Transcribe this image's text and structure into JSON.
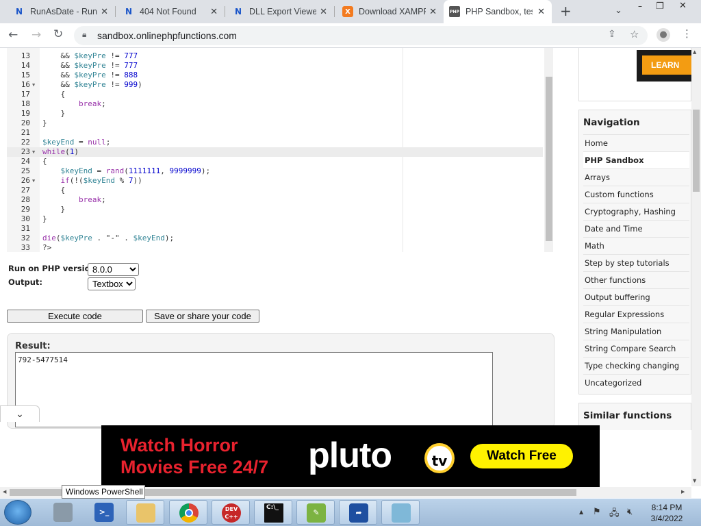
{
  "browser": {
    "tabs": [
      {
        "title": "RunAsDate - Run",
        "favicon": "N",
        "active": false
      },
      {
        "title": "404 Not Found",
        "favicon": "N",
        "active": false
      },
      {
        "title": "DLL Export Viewer",
        "favicon": "N",
        "active": false
      },
      {
        "title": "Download XAMPP",
        "favicon": "X",
        "active": false
      },
      {
        "title": "PHP Sandbox, tes",
        "favicon": "PHP",
        "active": true
      }
    ],
    "new_tab": "+",
    "url": "sandbox.onlinephpfunctions.com",
    "window_controls": {
      "minimize": "–",
      "restore": "❐",
      "close": "✕"
    }
  },
  "editor": {
    "lines": [
      {
        "n": "13",
        "fold": false,
        "code": "    && $keyPre != 777"
      },
      {
        "n": "14",
        "fold": false,
        "code": "    && $keyPre != 777"
      },
      {
        "n": "15",
        "fold": false,
        "code": "    && $keyPre != 888"
      },
      {
        "n": "16",
        "fold": true,
        "code": "    && $keyPre != 999)"
      },
      {
        "n": "17",
        "fold": false,
        "code": "    {"
      },
      {
        "n": "18",
        "fold": false,
        "code": "        break;"
      },
      {
        "n": "19",
        "fold": false,
        "code": "    }"
      },
      {
        "n": "20",
        "fold": false,
        "code": "}"
      },
      {
        "n": "21",
        "fold": false,
        "code": ""
      },
      {
        "n": "22",
        "fold": false,
        "code": "$keyEnd = null;"
      },
      {
        "n": "23",
        "fold": true,
        "code": "while(1)"
      },
      {
        "n": "24",
        "fold": false,
        "code": "{"
      },
      {
        "n": "25",
        "fold": false,
        "code": "    $keyEnd = rand(1111111, 9999999);"
      },
      {
        "n": "26",
        "fold": true,
        "code": "    if(!($keyEnd % 7))"
      },
      {
        "n": "27",
        "fold": false,
        "code": "    {"
      },
      {
        "n": "28",
        "fold": false,
        "code": "        break;"
      },
      {
        "n": "29",
        "fold": false,
        "code": "    }"
      },
      {
        "n": "30",
        "fold": false,
        "code": "}"
      },
      {
        "n": "31",
        "fold": false,
        "code": ""
      },
      {
        "n": "32",
        "fold": false,
        "code": "die($keyPre . \"-\" . $keyEnd);"
      },
      {
        "n": "33",
        "fold": false,
        "code": "?>"
      }
    ]
  },
  "controls": {
    "php_version_label": "Run on PHP version:",
    "php_version_value": "8.0.0",
    "output_label": "Output:",
    "output_value": "Textbox",
    "execute_label": "Execute code",
    "save_label": "Save or share your code"
  },
  "result": {
    "label": "Result:",
    "output": "792-5477514"
  },
  "sidebar": {
    "ad_button": "LEARN MORE",
    "nav_title": "Navigation",
    "items": [
      {
        "label": "Home",
        "current": false
      },
      {
        "label": "PHP Sandbox",
        "current": true
      },
      {
        "label": "Arrays",
        "current": false
      },
      {
        "label": "Custom functions",
        "current": false
      },
      {
        "label": "Cryptography, Hashing",
        "current": false
      },
      {
        "label": "Date and Time",
        "current": false
      },
      {
        "label": "Math",
        "current": false
      },
      {
        "label": "Step by step tutorials",
        "current": false
      },
      {
        "label": "Other functions",
        "current": false
      },
      {
        "label": "Output buffering",
        "current": false
      },
      {
        "label": "Regular Expressions",
        "current": false
      },
      {
        "label": "String Manipulation",
        "current": false
      },
      {
        "label": "String Compare Search",
        "current": false
      },
      {
        "label": "Type checking changing",
        "current": false
      },
      {
        "label": "Uncategorized",
        "current": false
      }
    ],
    "similar_title": "Similar functions"
  },
  "ad": {
    "line1": "Watch Horror",
    "line2": "Movies Free 24/7",
    "logo": "pluto",
    "logo_tv": "tv",
    "cta": "Watch Free"
  },
  "tooltip": "Windows PowerShell",
  "taskbar": {
    "apps": [
      "server-manager",
      "powershell",
      "file-explorer",
      "chrome",
      "dev-cpp",
      "cmd",
      "notepad-plus-plus",
      "app-arrow",
      "app-window"
    ],
    "dev_label": "DEV C++",
    "time": "8:14 PM",
    "date": "3/4/2022"
  }
}
